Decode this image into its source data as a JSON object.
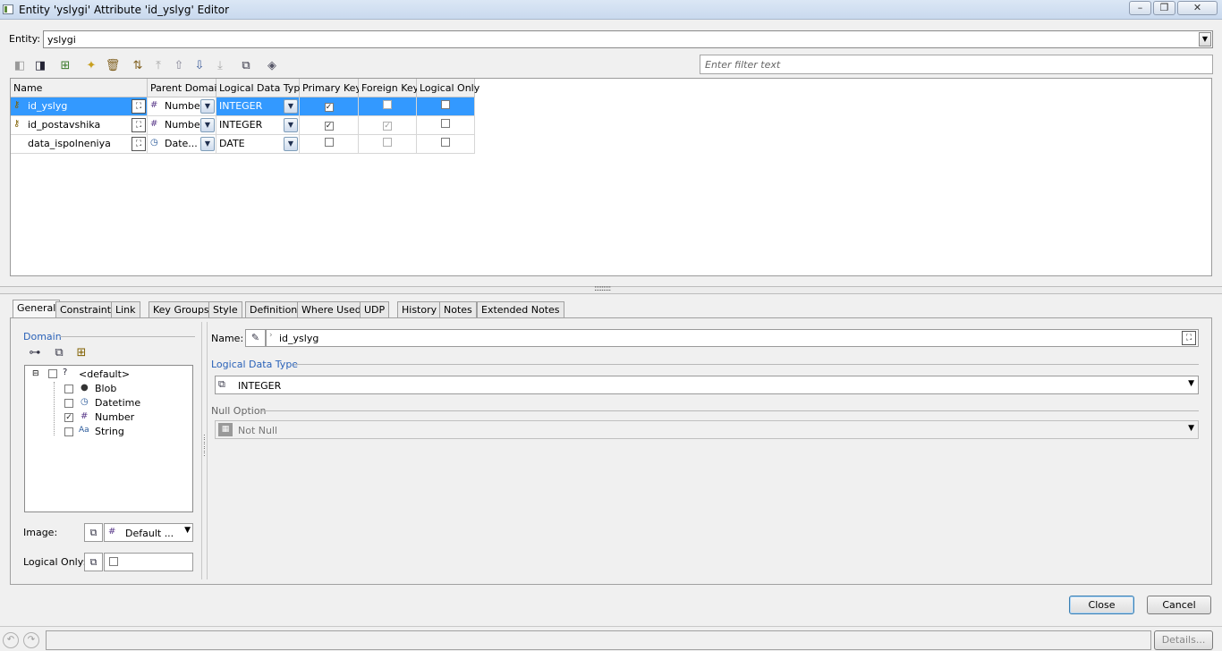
{
  "window": {
    "title": "Entity 'yslygi' Attribute 'id_yslyg' Editor"
  },
  "entity": {
    "label": "Entity:",
    "value": "yslygi"
  },
  "filter": {
    "placeholder": "Enter filter text"
  },
  "grid": {
    "columns": [
      "Name",
      "Parent Domain",
      "Logical Data Type",
      "Primary Key",
      "Foreign Key",
      "Logical Only"
    ],
    "rows": [
      {
        "name": "id_yslyg",
        "domain": "Number",
        "type": "INTEGER",
        "pk": true,
        "fk": false,
        "logical": false,
        "selected": true
      },
      {
        "name": "id_postavshika",
        "domain": "Number",
        "type": "INTEGER",
        "pk": true,
        "fk": true,
        "logical": false,
        "selected": false
      },
      {
        "name": "data_ispolneniya",
        "domain": "Date...",
        "type": "DATE",
        "pk": false,
        "fk": false,
        "logical": false,
        "selected": false
      }
    ]
  },
  "tabs": [
    "General",
    "Constraint",
    "Link",
    "Key Groups",
    "Style",
    "Definition",
    "Where Used",
    "UDP",
    "History",
    "Notes",
    "Extended Notes"
  ],
  "domain_panel": {
    "label": "Domain",
    "tree": {
      "root": "<default>",
      "children": [
        {
          "label": "Blob",
          "checked": false
        },
        {
          "label": "Datetime",
          "checked": false
        },
        {
          "label": "Number",
          "checked": true
        },
        {
          "label": "String",
          "checked": false
        }
      ]
    },
    "image_label": "Image:",
    "image_value": "Default ...",
    "logical_only_label": "Logical Only:"
  },
  "general": {
    "name_label": "Name:",
    "name_value": "id_yslyg",
    "logical_type_label": "Logical Data Type",
    "logical_type_value": "INTEGER",
    "null_option_label": "Null Option",
    "null_option_value": "Not Null"
  },
  "buttons": {
    "close": "Close",
    "cancel": "Cancel",
    "details": "Details..."
  },
  "colors": {
    "selection": "#3399ff",
    "group_label": "#2a62b8"
  }
}
